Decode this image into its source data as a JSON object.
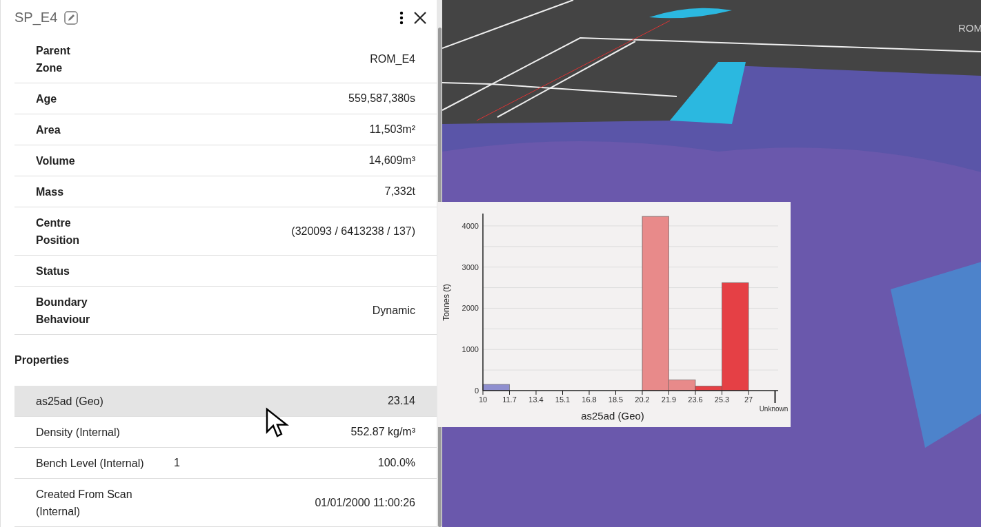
{
  "panel": {
    "title": "SP_E4",
    "attributes": [
      {
        "label": "Parent Zone",
        "value": "ROM_E4"
      },
      {
        "label": "Age",
        "value": "559,587,380s"
      },
      {
        "label": "Area",
        "value": "11,503m²"
      },
      {
        "label": "Volume",
        "value": "14,609m³"
      },
      {
        "label": "Mass",
        "value": "7,332t"
      },
      {
        "label": "Centre Position",
        "value": "(320093 / 6413238 / 137)"
      },
      {
        "label": "Status"
      },
      {
        "label": "Boundary Behaviour",
        "value": "Dynamic"
      }
    ],
    "properties_heading": "Properties",
    "properties": [
      {
        "label": "as25ad (Geo)",
        "value": "23.14",
        "selected": true
      },
      {
        "label": "Density (Internal)",
        "value": "552.87 kg/m³",
        "selected": false
      },
      {
        "label": "Bench Level (Internal)",
        "extra": "1",
        "value": "100.0%",
        "selected": false
      },
      {
        "label": "Created From Scan (Internal)",
        "value": "01/01/2000 11:00:26",
        "selected": false
      }
    ]
  },
  "viewport": {
    "label": "ROM"
  },
  "chart_data": {
    "type": "bar",
    "xlabel": "as25ad (Geo)",
    "ylabel": "Tonnes (t)",
    "categories": [
      "10",
      "11.7",
      "13.4",
      "15.1",
      "16.8",
      "18.5",
      "20.2",
      "21.9",
      "23.6",
      "25.3",
      "27",
      "Unknown"
    ],
    "values": [
      150,
      0,
      0,
      0,
      0,
      0,
      4230,
      260,
      110,
      2620,
      null,
      null
    ],
    "yticks": [
      0,
      1000,
      2000,
      3000,
      4000
    ],
    "ylim": [
      0,
      4300
    ],
    "grid": true
  }
}
